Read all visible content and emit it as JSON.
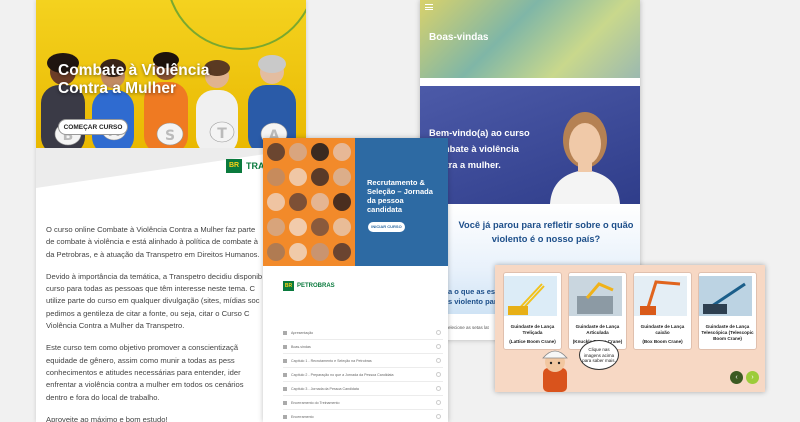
{
  "panel_combate": {
    "title": "Combate à Violência Contra a Mulher",
    "start_button": "COMEÇAR CURSO",
    "logo_mark": "BR",
    "logo_text": "TRA",
    "paragraphs": [
      "O curso online Combate à Violência Contra a Mulher faz parte",
      "de combate à violência e está alinhado à política de combate à",
      "da Petrobras, e à atuação da Transpetro em Direitos Humanos.",
      "Devido à importância da temática, a Transpetro decidiu disponib",
      "curso para todas as pessoas que têm interesse neste tema. C",
      "utilize parte do curso em qualquer divulgação (sites, mídias soc",
      "pedimos a gentileza de citar a fonte, ou seja, citar o Curso C",
      "Violência Contra a Mulher da Transpetro.",
      "Este curso tem como objetivo promover a conscientizaçã",
      "equidade de gênero, assim como munir a todas as pess",
      "conhecimentos e atitudes necessárias para entender, ider",
      "enfrentar a violência contra a mulher em todos os cenários",
      "dentro e fora do local de trabalho.",
      "Aproveite ao máximo e bom estudo!"
    ]
  },
  "panel_recrutamento": {
    "heading": "Recrutamento & Seleção – Jornada da pessoa candidata",
    "start_button": "INICIAR CURSO",
    "logo_mark": "BR",
    "logo_text": "PETROBRAS",
    "modules": [
      "Apresentação",
      "Boas-vindas",
      "Capítulo 1 - Recrutamento e Seleção na Petrobras",
      "Capítulo 2 - Preparação no que a Jornada da Pessoa Candidata",
      "Capítulo 3 - Jornada da Pessoa Candidata",
      "Encerramento do Treinamento",
      "Encerramento"
    ]
  },
  "panel_boasvindas": {
    "title": "Boas-vindas",
    "welcome": "Bem-vindo(a) ao curso Combate à violência contra a mulher.",
    "question": "Você já parou para refletir sobre o quão violento é o nosso país?",
    "question2_line1": "a o que as esta",
    "question2_line2": "s violento para",
    "footer": "elecione as setas lat"
  },
  "panel_guindastes": {
    "cards": [
      {
        "title": "Guindaste de Lança Treliçada",
        "subtitle": "(Lattice Boom Crane)"
      },
      {
        "title": "Guindaste de Lança Articulada",
        "subtitle": "(Knuckle Boom Crane)"
      },
      {
        "title": "Guindaste de Lança caixão",
        "subtitle": "(Box Boom Crane)"
      },
      {
        "title": "Guindaste de Lança Telescópica (Telescopic Boom Crane)",
        "subtitle": ""
      }
    ],
    "bubble": "Clique nas imagens acima para saber mais.",
    "prev_icon": "‹",
    "next_icon": "›"
  }
}
